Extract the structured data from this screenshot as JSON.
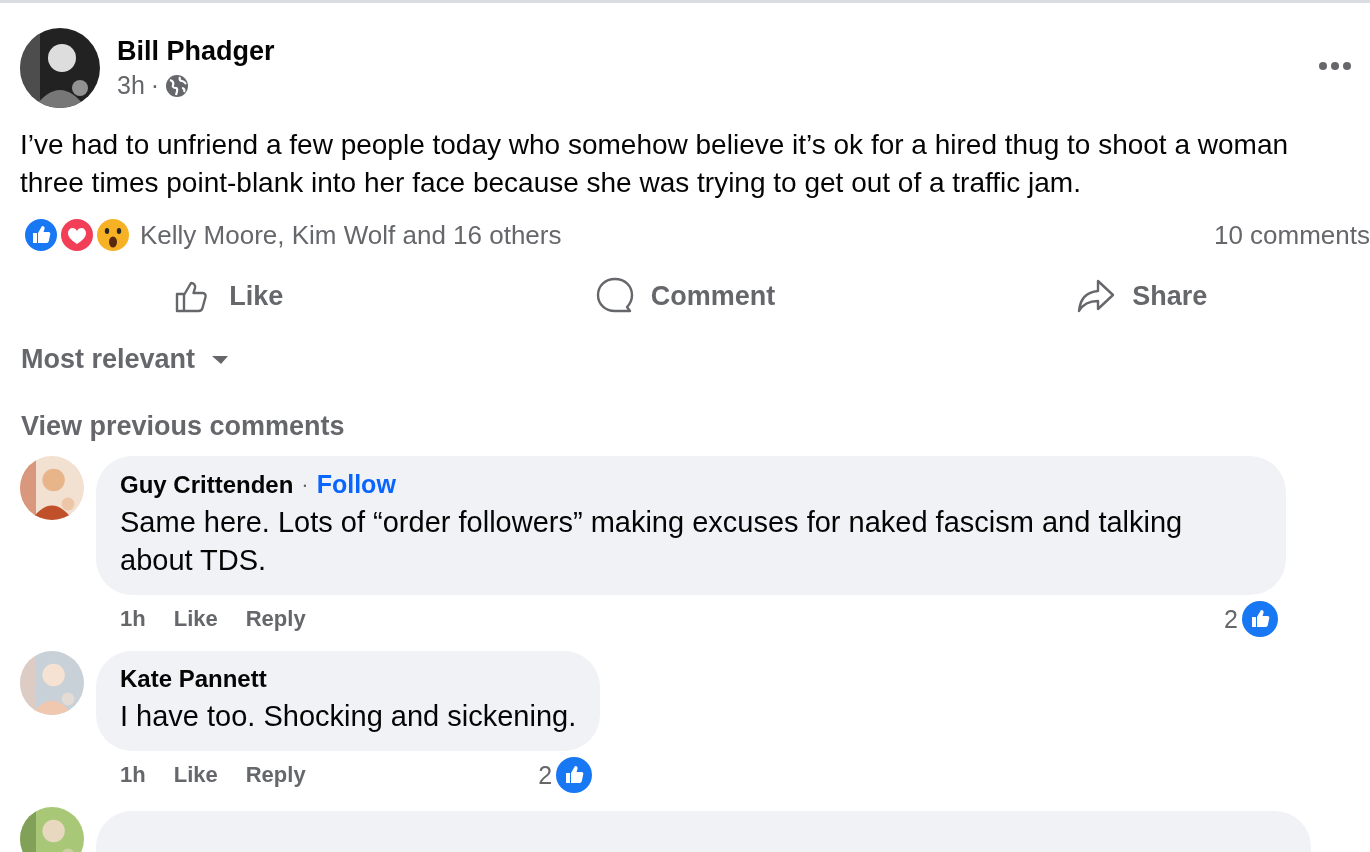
{
  "post": {
    "author": "Bill Phadger",
    "time": "3h",
    "separator": "·",
    "text": "I’ve had to unfriend a few people today who somehow believe it’s ok for a hired thug to shoot a woman three times point-blank into her face because she was trying to get out of a traffic jam."
  },
  "reactions": {
    "icons": [
      {
        "kind": "like"
      },
      {
        "kind": "love"
      },
      {
        "kind": "wow"
      }
    ],
    "names": "Kelly Moore, Kim Wolf and 16 others",
    "comments_count": "10 comments"
  },
  "actions": [
    {
      "kind": "like",
      "label": "Like"
    },
    {
      "kind": "comment",
      "label": "Comment"
    },
    {
      "kind": "share",
      "label": "Share"
    }
  ],
  "sort": {
    "label": "Most relevant"
  },
  "view_previous": "View previous comments",
  "comments": [
    {
      "author": "Guy Crittenden",
      "separator": "·",
      "follow": "Follow",
      "text": "Same here. Lots of “order followers” making excuses for naked fascism and talking about TDS.",
      "time": "1h",
      "like": "Like",
      "reply": "Reply",
      "like_count": "2"
    },
    {
      "author": "Kate Pannett",
      "text": "I have too. Shocking and sickening.",
      "time": "1h",
      "like": "Like",
      "reply": "Reply",
      "like_count": "2"
    }
  ]
}
